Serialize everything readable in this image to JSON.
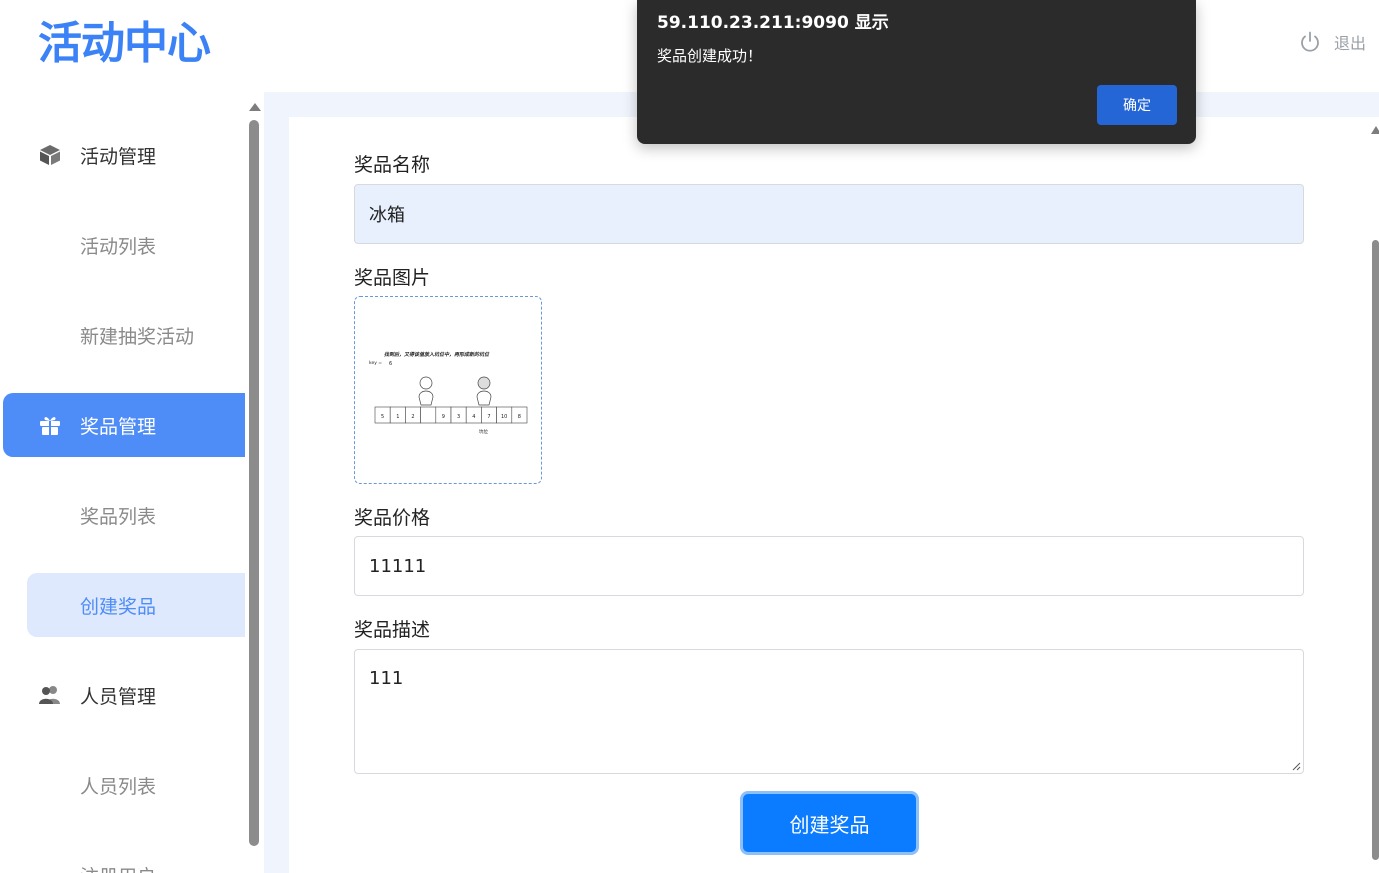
{
  "header": {
    "logo_text": "活动中心",
    "logout_label": "退出"
  },
  "sidebar": {
    "items": [
      {
        "label": "活动管理",
        "icon": "cube-icon"
      },
      {
        "label": "活动列表"
      },
      {
        "label": "新建抽奖活动"
      },
      {
        "label": "奖品管理",
        "icon": "gift-icon"
      },
      {
        "label": "奖品列表"
      },
      {
        "label": "创建奖品"
      },
      {
        "label": "人员管理",
        "icon": "users-icon"
      },
      {
        "label": "人员列表"
      },
      {
        "label": "注册用户"
      }
    ],
    "active_group": "奖品管理",
    "active_item": "创建奖品"
  },
  "form": {
    "name_label": "奖品名称",
    "name_value": "冰箱",
    "image_label": "奖品图片",
    "image_caption": "找到后，又得该值放入坑位中，再形成新的坑位",
    "image_key_text": "key =",
    "image_key_value": "6",
    "image_cells": [
      "5",
      "1",
      "2",
      "",
      "9",
      "3",
      "4",
      "7",
      "10",
      "8"
    ],
    "image_bottom_label": "坑位",
    "price_label": "奖品价格",
    "price_value": "11111",
    "desc_label": "奖品描述",
    "desc_value": "111",
    "submit_label": "创建奖品"
  },
  "dialog": {
    "title": "59.110.23.211:9090 显示",
    "message": "奖品创建成功！",
    "ok_label": "确定"
  },
  "colors": {
    "accent": "#4e8cf7",
    "button": "#0b7bff",
    "dialog_bg": "#2b2b2b",
    "dialog_button": "#2466d6"
  }
}
